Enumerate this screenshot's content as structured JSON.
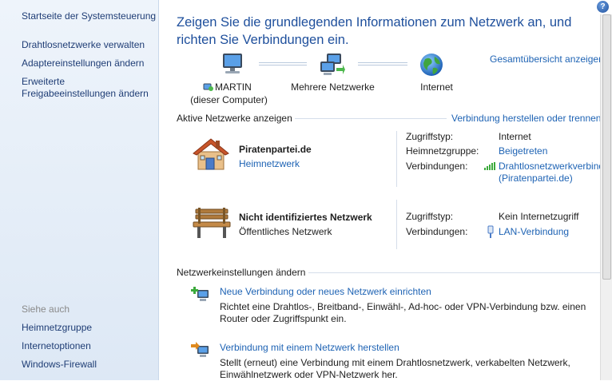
{
  "sidebar": {
    "home": "Startseite der Systemsteuerung",
    "links": [
      "Drahtlosnetzwerke verwalten",
      "Adaptereinstellungen ändern",
      "Erweiterte Freigabeeinstellungen ändern"
    ],
    "see_also_heading": "Siehe auch",
    "see_also": [
      "Heimnetzgruppe",
      "Internetoptionen",
      "Windows-Firewall"
    ]
  },
  "help_glyph": "?",
  "title": "Zeigen Sie die grundlegenden Informationen zum Netzwerk an, und richten Sie Verbindungen ein.",
  "network_map": {
    "overview_link": "Gesamtübersicht anzeigen",
    "computer_name": "MARTIN",
    "computer_sub": "(dieser Computer)",
    "middle": "Mehrere Netzwerke",
    "internet": "Internet"
  },
  "active_networks": {
    "heading": "Aktive Netzwerke anzeigen",
    "connect_link": "Verbindung herstellen oder trennen",
    "networks": [
      {
        "name": "Piratenpartei.de",
        "type": "Heimnetzwerk",
        "icon": "house-icon",
        "access_label": "Zugriffstyp:",
        "access_value": "Internet",
        "homegroup_label": "Heimnetzgruppe:",
        "homegroup_value": "Beigetreten",
        "connections_label": "Verbindungen:",
        "connection_value": "Drahtlosnetzwerkverbind",
        "connection_sub": "(Piratenpartei.de)"
      },
      {
        "name": "Nicht identifiziertes Netzwerk",
        "type": "Öffentliches Netzwerk",
        "icon": "bench-icon",
        "access_label": "Zugriffstyp:",
        "access_value": "Kein Internetzugriff",
        "connections_label": "Verbindungen:",
        "connection_value": "LAN-Verbindung"
      }
    ]
  },
  "settings": {
    "heading": "Netzwerkeinstellungen ändern",
    "tasks": [
      {
        "title": "Neue Verbindung oder neues Netzwerk einrichten",
        "desc": "Richtet eine Drahtlos-, Breitband-, Einwähl-, Ad-hoc- oder VPN-Verbindung bzw. einen Router oder Zugriffspunkt ein."
      },
      {
        "title": "Verbindung mit einem Netzwerk herstellen",
        "desc": "Stellt (erneut) eine Verbindung mit einem Drahtlosnetzwerk, verkabelten Netzwerk, Einwählnetzwerk oder VPN-Netzwerk her."
      }
    ]
  },
  "colors": {
    "link": "#1e63b4",
    "title": "#1e4f9c",
    "sidebar_link": "#1f3d75",
    "sidebar_bg": "#e6eef8"
  }
}
